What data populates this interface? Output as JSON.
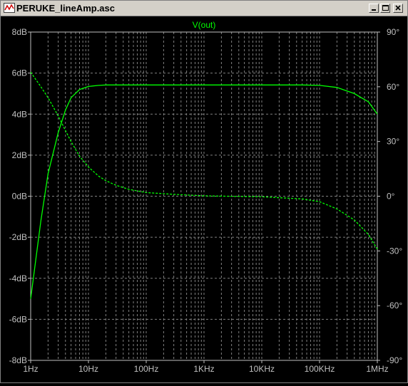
{
  "window": {
    "title": "PERUKE_lineAmp.asc",
    "minimize_icon": "minimize-icon",
    "maximize_icon": "maximize-icon",
    "close_icon": "close-icon"
  },
  "colors": {
    "background": "#000000",
    "trace": "#00ff00",
    "grid": "#808080",
    "axis_text": "#c0c0c0"
  },
  "chart_data": {
    "type": "line",
    "title": "V(out)",
    "x_scale": "log",
    "xlim": [
      1,
      1000000
    ],
    "x_tick_labels": [
      "1Hz",
      "10Hz",
      "100Hz",
      "1KHz",
      "10KHz",
      "100KHz",
      "1MHz"
    ],
    "x_tick_values": [
      1,
      10,
      100,
      1000,
      10000,
      100000,
      1000000
    ],
    "ylim_left": [
      -8,
      8
    ],
    "y_left_ticks": [
      "8dB",
      "6dB",
      "4dB",
      "2dB",
      "0dB",
      "-2dB",
      "-4dB",
      "-6dB",
      "-8dB"
    ],
    "y_left_tick_values": [
      8,
      6,
      4,
      2,
      0,
      -2,
      -4,
      -6,
      -8
    ],
    "ylim_right": [
      -90,
      90
    ],
    "y_right_ticks": [
      "90°",
      "60°",
      "30°",
      "0°",
      "-30°",
      "-60°",
      "-90°"
    ],
    "y_right_tick_values": [
      90,
      60,
      30,
      0,
      -30,
      -60,
      -90
    ],
    "grid": true,
    "series": [
      {
        "style": "solid",
        "axis": "left",
        "x": [
          1,
          1.5,
          2,
          3,
          4,
          5,
          7,
          10,
          15,
          20,
          30,
          50,
          100,
          1000,
          10000,
          50000,
          100000,
          200000,
          400000,
          700000,
          1000000
        ],
        "y": [
          -5.0,
          -1.2,
          1.1,
          3.1,
          4.2,
          4.8,
          5.2,
          5.35,
          5.4,
          5.42,
          5.42,
          5.42,
          5.42,
          5.42,
          5.42,
          5.42,
          5.4,
          5.3,
          5.0,
          4.6,
          4.0
        ]
      },
      {
        "style": "dashed",
        "axis": "right",
        "x": [
          1,
          1.5,
          2,
          3,
          4,
          5,
          7,
          10,
          15,
          20,
          30,
          50,
          100,
          300,
          1000,
          10000,
          50000,
          100000,
          200000,
          400000,
          700000,
          1000000
        ],
        "y": [
          68,
          60,
          54,
          44,
          36,
          30,
          22,
          16,
          11,
          8.5,
          6,
          3.8,
          2,
          1,
          0.2,
          -0.3,
          -1.5,
          -3,
          -7,
          -13,
          -21,
          -29
        ]
      }
    ]
  }
}
